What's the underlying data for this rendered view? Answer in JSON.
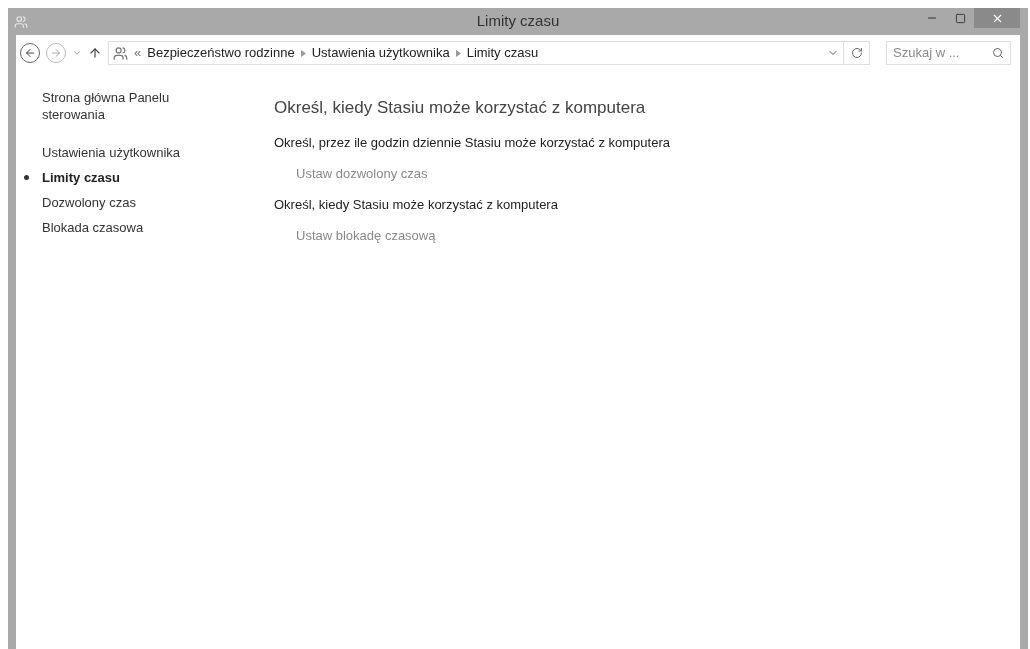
{
  "window": {
    "title": "Limity czasu"
  },
  "address_bar": {
    "crumbs": [
      "Bezpieczeństwo rodzinne",
      "Ustawienia użytkownika",
      "Limity czasu"
    ],
    "overflow": "«"
  },
  "search": {
    "placeholder": "Szukaj w ..."
  },
  "sidebar": {
    "home": "Strona główna Panelu sterowania",
    "items": [
      {
        "label": "Ustawienia użytkownika",
        "selected": false
      },
      {
        "label": "Limity czasu",
        "selected": true
      },
      {
        "label": "Dozwolony czas",
        "selected": false
      },
      {
        "label": "Blokada czasowa",
        "selected": false
      }
    ]
  },
  "main": {
    "heading": "Określ, kiedy Stasiu może korzystać z komputera",
    "sections": [
      {
        "description": "Określ, przez ile godzin dziennie Stasiu może korzystać z komputera",
        "link": "Ustaw dozwolony czas"
      },
      {
        "description": "Określ, kiedy Stasiu może korzystać z komputera",
        "link": "Ustaw blokadę czasową"
      }
    ]
  }
}
